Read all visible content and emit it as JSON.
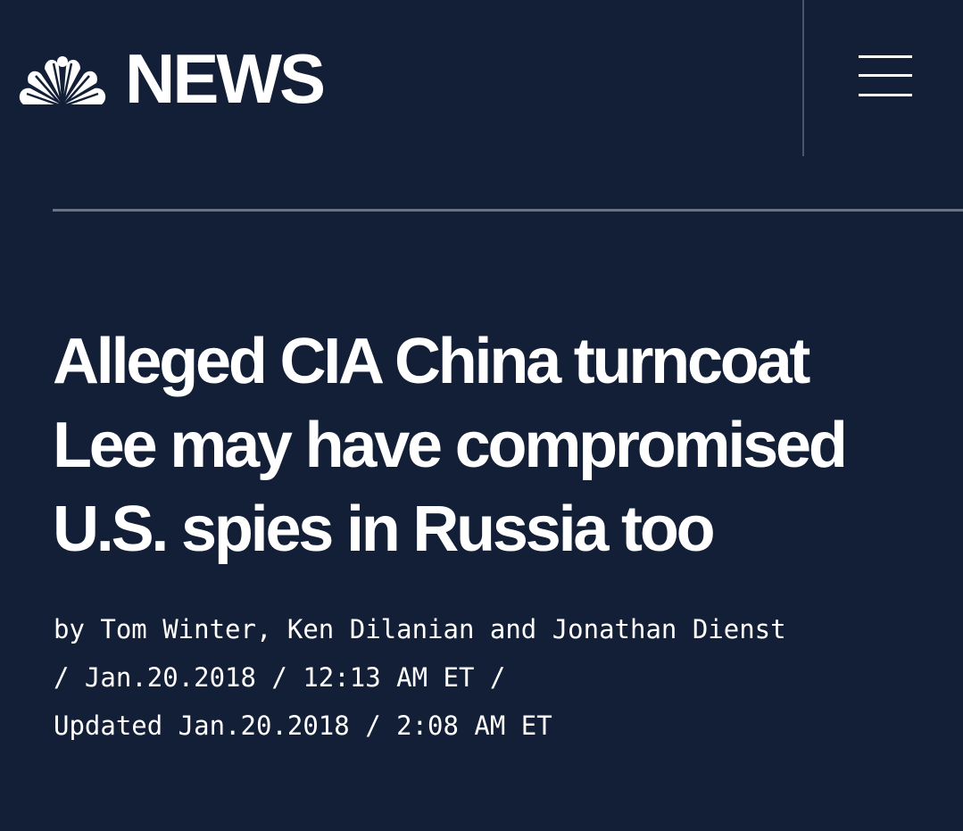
{
  "header": {
    "brand": "NEWS",
    "logo_icon": "nbc-peacock-icon",
    "menu_icon": "hamburger-menu-icon",
    "background_color": "#131f36"
  },
  "article": {
    "headline_lines": [
      "Alleged CIA China turncoat",
      "Lee may have compromised",
      "U.S. spies in Russia too"
    ],
    "byline": {
      "line1": "by Tom Winter, Ken Dilanian and Jonathan Dienst",
      "line2": "/ Jan.20.2018 / 12:13 AM ET /",
      "line3": "Updated Jan.20.2018 / 2:08 AM ET"
    }
  }
}
